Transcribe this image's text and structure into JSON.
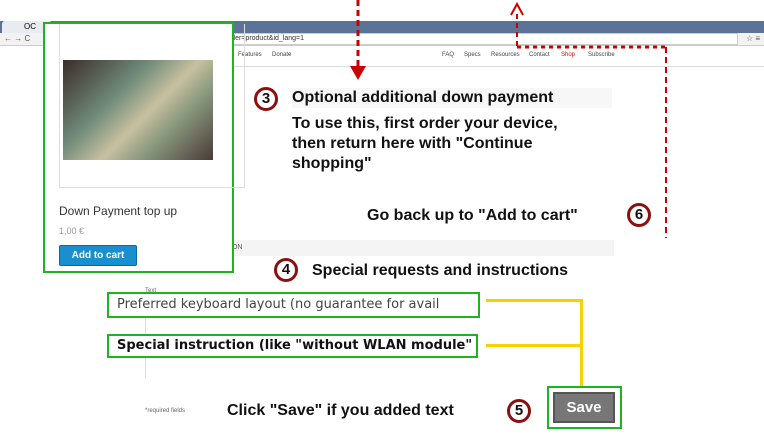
{
  "browser": {
    "tab_title": "OC",
    "url": "ller=product&id_lang=1"
  },
  "nav": [
    "Features",
    "Donate",
    "FAQ",
    "Specs",
    "Resources",
    "Contact",
    "Shop",
    "Subscribe"
  ],
  "product": {
    "title": "Down Payment top up",
    "price": "1,00 €",
    "add_to_cart": "Add to cart"
  },
  "form": {
    "section_heading": "ION",
    "field_label": "Text",
    "field1_value": "Preferred keyboard layout (no guarantee for avail",
    "field2_value": "Special instruction (like \"without WLAN module\" -",
    "required_note": "*required fields",
    "save_label": "Save"
  },
  "annotations": {
    "step3_num": "3",
    "step3_title": "Optional additional down payment",
    "step3_body": "To use this, first order your device, then return here with \"Continue shopping\"",
    "step6_num": "6",
    "step6_text": "Go back up to \"Add to cart\"",
    "step4_num": "4",
    "step4_text": "Special requests and instructions",
    "step5_num": "5",
    "step5_text": "Click \"Save\" if you added text"
  },
  "colors": {
    "annotation_red": "#cc0000",
    "highlight_green": "#1fb31f",
    "connector_yellow": "#f6d200",
    "button_blue": "#1a8fd0"
  }
}
